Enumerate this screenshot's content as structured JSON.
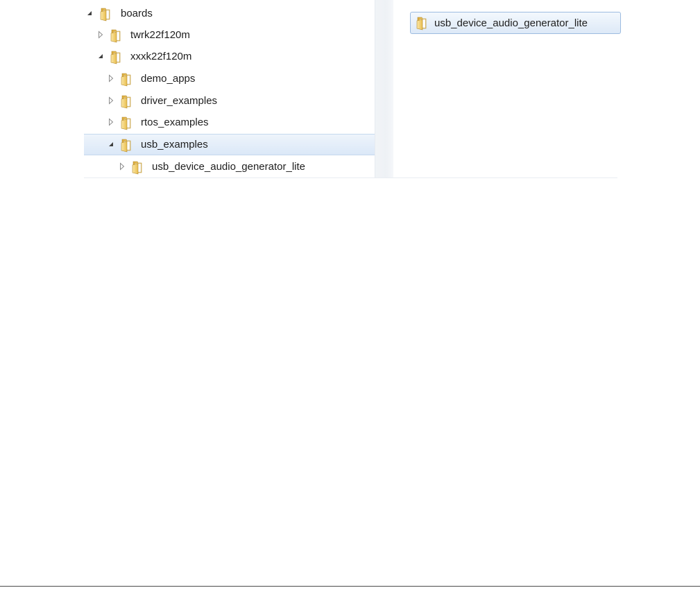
{
  "tree": {
    "items": [
      {
        "label": "boards",
        "expanded": true,
        "selected": false
      },
      {
        "label": "twrk22f120m",
        "expanded": false,
        "selected": false
      },
      {
        "label": "xxxk22f120m",
        "expanded": true,
        "selected": false
      },
      {
        "label": "demo_apps",
        "expanded": false,
        "selected": false
      },
      {
        "label": "driver_examples",
        "expanded": false,
        "selected": false
      },
      {
        "label": "rtos_examples",
        "expanded": false,
        "selected": false
      },
      {
        "label": "usb_examples",
        "expanded": true,
        "selected": true
      },
      {
        "label": "usb_device_audio_generator_lite",
        "expanded": false,
        "selected": false
      }
    ]
  },
  "content": {
    "items": [
      {
        "label": "usb_device_audio_generator_lite",
        "icon": "folder-icon"
      }
    ]
  },
  "colors": {
    "folder": "#e8c25a",
    "selection": "#dbe8f8",
    "selection_border": "#9cbbe0",
    "text": "#1e1e1e"
  }
}
